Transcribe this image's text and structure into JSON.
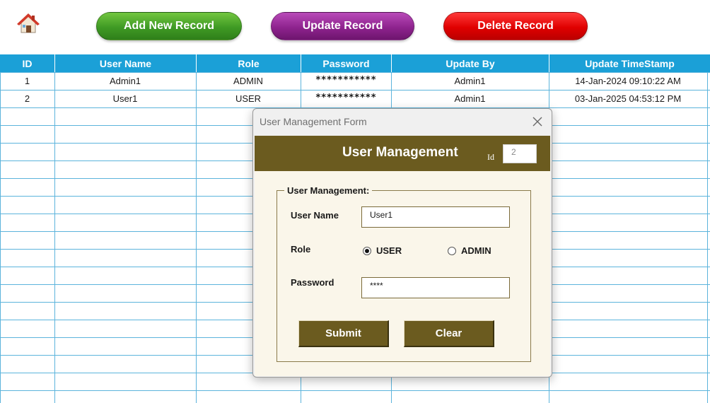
{
  "toolbar": {
    "home_icon": "home-icon",
    "add_label": "Add New Record",
    "update_label": "Update Record",
    "delete_label": "Delete Record",
    "colors": {
      "add": "#3f9a24",
      "update": "#8e238e",
      "delete": "#e00000"
    }
  },
  "table": {
    "headers": [
      "ID",
      "User Name",
      "Role",
      "Password",
      "Update By",
      "Update TimeStamp"
    ],
    "header_color": "#1ba0d7",
    "rows": [
      {
        "id": "1",
        "user_name": "Admin1",
        "role": "ADMIN",
        "password": "***********",
        "update_by": "Admin1",
        "timestamp": "14-Jan-2024 09:10:22 AM"
      },
      {
        "id": "2",
        "user_name": "User1",
        "role": "USER",
        "password": "***********",
        "update_by": "Admin1",
        "timestamp": "03-Jan-2025 04:53:12 PM"
      }
    ]
  },
  "dialog": {
    "window_title": "User Management Form",
    "banner_title": "User Management",
    "id_label": "Id",
    "id_value": "2",
    "group_title": "User Management:",
    "user_name_label": "User Name",
    "user_name_value": "User1",
    "role_label": "Role",
    "role_options": [
      "USER",
      "ADMIN"
    ],
    "role_selected": "USER",
    "password_label": "Password",
    "password_value": "****",
    "submit_label": "Submit",
    "clear_label": "Clear",
    "accent_color": "#6b5b1f"
  }
}
